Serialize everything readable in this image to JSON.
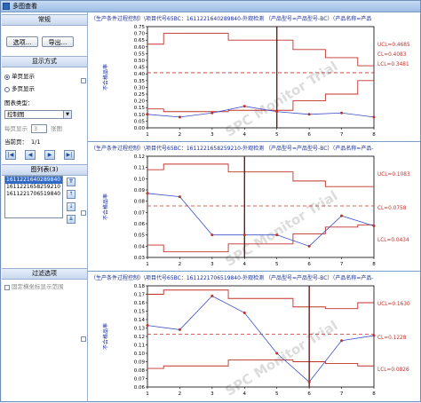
{
  "window": {
    "title": "多图查看"
  },
  "left": {
    "common": {
      "header": "常规",
      "options_button": "选项...",
      "export_button": "导出..."
    },
    "display_mode": {
      "header": "显示方式",
      "single_page": "单页显示",
      "multi_page": "多页显示",
      "chart_type_label": "图表类型：",
      "chart_type_value": "控制图",
      "per_page_label": "每页显示",
      "per_page_value": "3",
      "per_page_unit": "张图",
      "current_page_label": "当前页：",
      "current_page_value": "1/1"
    },
    "chart_list": {
      "header": "图列表(3)",
      "items": [
        "1611221640289840",
        "1611221658259210",
        "1611221706519840"
      ]
    },
    "filter": {
      "header": "过滤选项",
      "fixed_range": "固定横坐标显示范围"
    }
  },
  "watermark": "SPC Monitor Trial",
  "chart_data": [
    {
      "type": "line",
      "title": "（生产条件过程控制）\\项目代号65BC：1611221640289840-外观检测  （产品型号=产品型号-BC）（产品名称=产品",
      "ylabel": "不合格品率",
      "x": [
        1,
        2,
        3,
        4,
        5,
        6,
        7,
        8
      ],
      "x_ticks": [
        "1",
        "2",
        "3",
        "4",
        "5",
        "6",
        "7",
        "8"
      ],
      "ylim": [
        0.0,
        0.75
      ],
      "y_ticks": [
        "0.00",
        "0.05",
        "0.10",
        "0.15",
        "0.20",
        "0.25",
        "0.30",
        "0.35",
        "0.40",
        "0.45",
        "0.50",
        "0.55",
        "0.60",
        "0.65",
        "0.70",
        "0.75"
      ],
      "values": [
        0.1,
        0.08,
        0.11,
        0.16,
        0.12,
        0.1,
        0.11,
        0.08
      ],
      "cl": 0.4083,
      "ucl_steps": [
        0.62,
        0.7,
        0.7,
        0.65,
        0.65,
        0.58,
        0.52,
        0.46
      ],
      "lcl_steps": [
        0.14,
        0.12,
        0.12,
        0.13,
        0.13,
        0.2,
        0.25,
        0.35
      ],
      "ucl_label": "UCL=0.4685",
      "cl_label": "CL=0.4083",
      "lcl_label": "LCL=0.3481",
      "marker_x": 5
    },
    {
      "type": "line",
      "title": "（生产条件过程控制）\\项目代号65BC：1611221658259210-外观检测  （产品型号=产品型号-BC）（产品名称=产品-",
      "ylabel": "不合格品率",
      "x": [
        1,
        2,
        3,
        4,
        5,
        6,
        7,
        8
      ],
      "x_ticks": [
        "1",
        "2",
        "3",
        "4",
        "5",
        "6",
        "7",
        "8"
      ],
      "ylim": [
        0.03,
        0.12
      ],
      "y_ticks": [
        "0.03",
        "0.04",
        "0.05",
        "0.06",
        "0.07",
        "0.08",
        "0.09",
        "0.10",
        "0.11",
        "0.12"
      ],
      "values": [
        0.087,
        0.084,
        0.05,
        0.05,
        0.05,
        0.04,
        0.067,
        0.058
      ],
      "cl": 0.0758,
      "ucl_steps": [
        0.108,
        0.113,
        0.113,
        0.106,
        0.106,
        0.098,
        0.093,
        0.093
      ],
      "lcl_steps": [
        0.041,
        0.035,
        0.035,
        0.042,
        0.042,
        0.051,
        0.057,
        0.059
      ],
      "ucl_label": "UCL=0.1083",
      "cl_label": "CL=0.0758",
      "lcl_label": "LCL=0.0434",
      "marker_x": 4
    },
    {
      "type": "line",
      "title": "（生产条件过程控制）\\项目代号65BC：1611221706519840-外观检测  （产品型号=产品型号-BC）（产品名称=产品-",
      "ylabel": "不合格品率",
      "x": [
        1,
        2,
        3,
        4,
        5,
        6,
        7,
        8
      ],
      "x_ticks": [
        "1",
        "2",
        "3",
        "4",
        "5",
        "6",
        "7",
        "8"
      ],
      "ylim": [
        0.06,
        0.18
      ],
      "y_ticks": [
        "0.06",
        "0.07",
        "0.08",
        "0.09",
        "0.10",
        "0.11",
        "0.12",
        "0.13",
        "0.14",
        "0.15",
        "0.16",
        "0.17",
        "0.18"
      ],
      "values": [
        0.133,
        0.128,
        0.168,
        0.148,
        0.1,
        0.066,
        0.115,
        0.121
      ],
      "cl": 0.1228,
      "ucl_steps": [
        0.17,
        0.175,
        0.175,
        0.165,
        0.165,
        0.155,
        0.153,
        0.16
      ],
      "lcl_steps": [
        0.082,
        0.085,
        0.085,
        0.092,
        0.092,
        0.09,
        0.088,
        0.085
      ],
      "ucl_label": "UCL=0.1630",
      "cl_label": "CL=0.1228",
      "lcl_label": "LCL=0.0826",
      "marker_x": 6
    }
  ],
  "colors": {
    "limit_line": "#c0302a",
    "series": "#3a4fc8",
    "point": "#c0302a",
    "marker": "#5a1010",
    "title_text": "#1a2f9c",
    "axis_label": "#1a2f9c"
  }
}
